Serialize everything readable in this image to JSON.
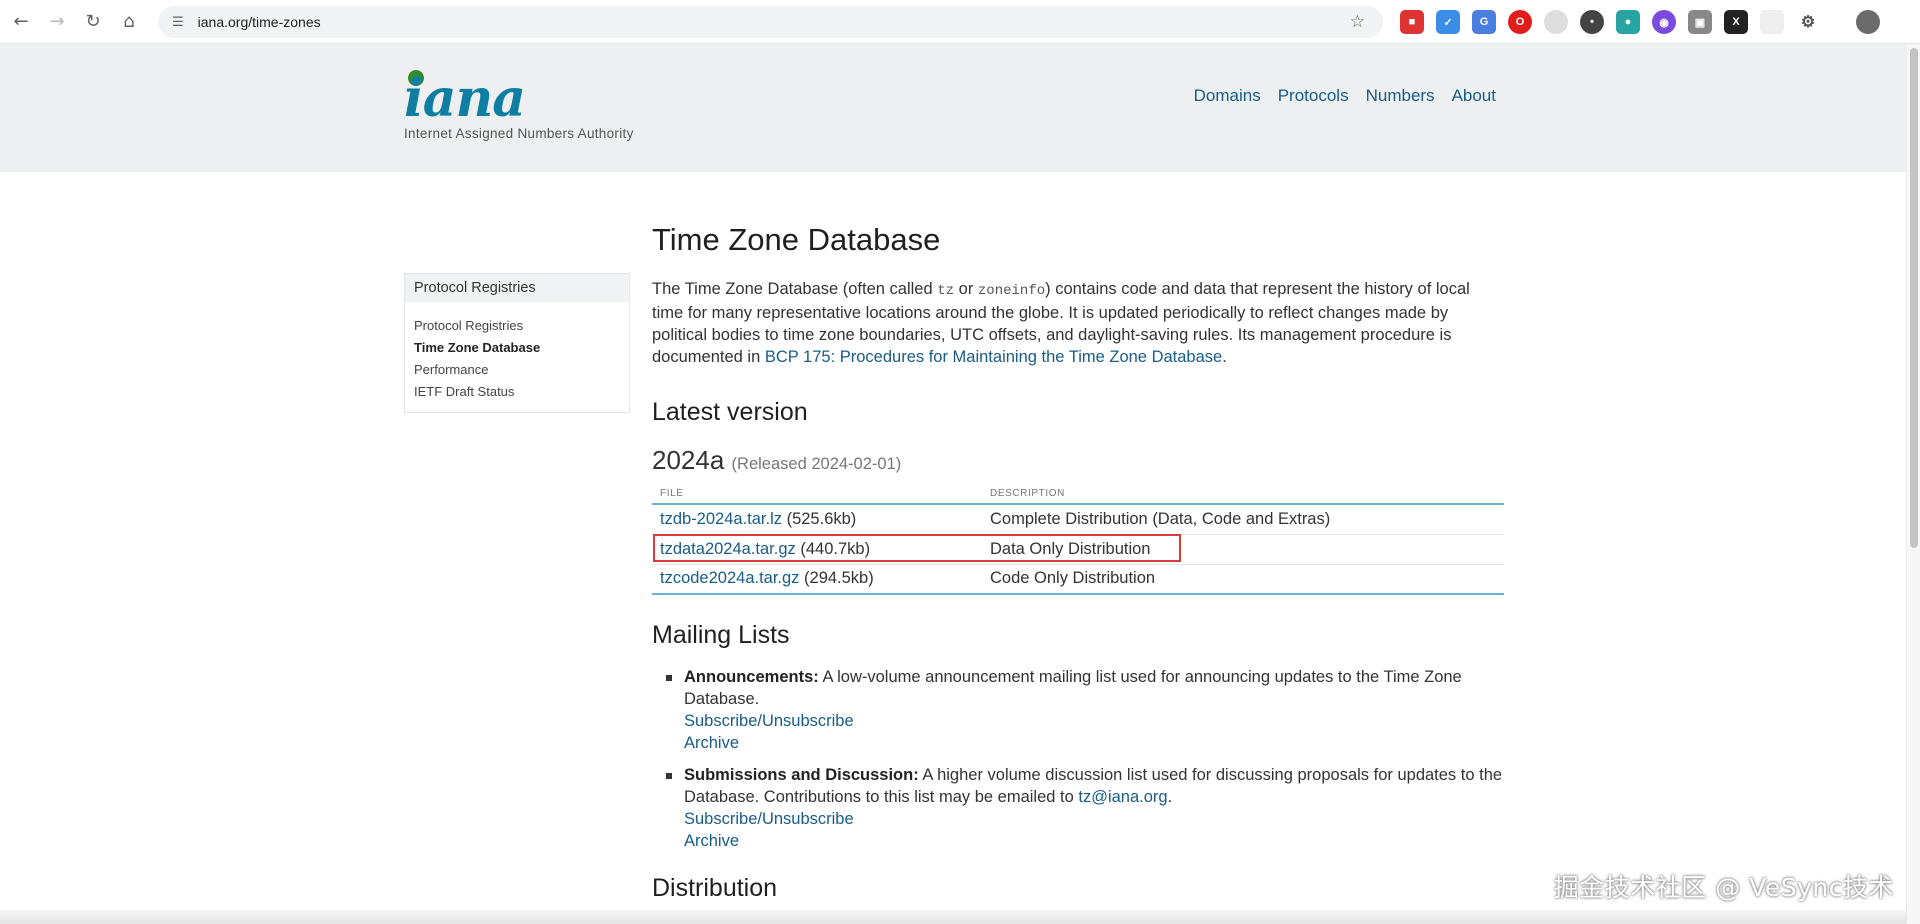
{
  "browser": {
    "url": "iana.org/time-zones",
    "back_icon": "back-arrow-icon",
    "forward_icon": "forward-arrow-icon",
    "reload_icon": "reload-icon",
    "home_icon": "home-icon"
  },
  "header": {
    "logo_text": "iana",
    "logo_subtitle": "Internet Assigned Numbers Authority",
    "nav": [
      "Domains",
      "Protocols",
      "Numbers",
      "About"
    ]
  },
  "sidebar": {
    "title": "Protocol Registries",
    "items": [
      {
        "label": "Protocol Registries",
        "active": false
      },
      {
        "label": "Time Zone Database",
        "active": true
      },
      {
        "label": "Performance",
        "active": false
      },
      {
        "label": "IETF Draft Status",
        "active": false
      }
    ]
  },
  "main": {
    "title": "Time Zone Database",
    "intro": {
      "p1": "The Time Zone Database (often called ",
      "code1": "tz",
      "p2": " or ",
      "code2": "zoneinfo",
      "p3": ") contains code and data that represent the history of local time for many representative locations around the globe. It is updated periodically to reflect changes made by political bodies to time zone boundaries, UTC offsets, and daylight-saving rules. Its management procedure is documented in ",
      "link": "BCP 175: Procedures for Maintaining the Time Zone Database",
      "p4": "."
    },
    "latest_heading": "Latest version",
    "version": "2024a",
    "released": "(Released 2024-02-01)",
    "table": {
      "headers": [
        "FILE",
        "DESCRIPTION"
      ],
      "rows": [
        {
          "file": "tzdb-2024a.tar.lz",
          "size": " (525.6kb)",
          "desc": "Complete Distribution (Data, Code and Extras)"
        },
        {
          "file": "tzdata2024a.tar.gz",
          "size": " (440.7kb)",
          "desc": "Data Only Distribution"
        },
        {
          "file": "tzcode2024a.tar.gz",
          "size": " (294.5kb)",
          "desc": "Code Only Distribution"
        }
      ]
    },
    "mailing_heading": "Mailing Lists",
    "mailing": [
      {
        "title": "Announcements:",
        "text": " A low-volume announcement mailing list used for announcing updates to the Time Zone Database.",
        "subscribe": "Subscribe/Unsubscribe",
        "archive": "Archive"
      },
      {
        "title": "Submissions and Discussion:",
        "text": " A higher volume discussion list used for discussing proposals for updates to the Database. Contributions to this list may be emailed to ",
        "email": "tz@iana.org",
        "text_end": ".",
        "subscribe": "Subscribe/Unsubscribe",
        "archive": "Archive"
      }
    ],
    "distribution_heading": "Distribution"
  },
  "watermark": "掘金技术社区 @ VeSync技术",
  "colors": {
    "link": "#185d87",
    "header_bg": "#edeff1",
    "table_rule": "#6bb3d0",
    "highlight": "#d93a3a"
  }
}
